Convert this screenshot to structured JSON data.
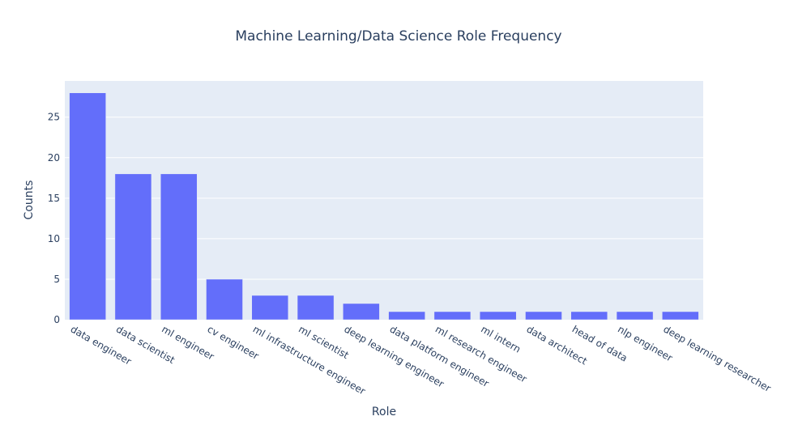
{
  "chart_data": {
    "type": "bar",
    "title": "Machine Learning/Data Science Role Frequency",
    "xlabel": "Role",
    "ylabel": "Counts",
    "categories": [
      "data engineer",
      "data scientist",
      "ml engineer",
      "cv engineer",
      "ml infrastructure engineer",
      "ml scientist",
      "deep learning engineer",
      "data platform engineer",
      "ml research engineer",
      "ml intern",
      "data architect",
      "head of data",
      "nlp engineer",
      "deep learning researcher"
    ],
    "values": [
      28,
      18,
      18,
      5,
      3,
      3,
      2,
      1,
      1,
      1,
      1,
      1,
      1,
      1
    ],
    "ylim": [
      0,
      29.47
    ],
    "yticks": [
      0,
      5,
      10,
      15,
      20,
      25
    ],
    "grid": true,
    "legend": "none",
    "colors": {
      "bar": "#636efa",
      "plot_bg": "#e5ecf6",
      "grid": "#ffffff",
      "text": "#2a3f5f"
    }
  }
}
